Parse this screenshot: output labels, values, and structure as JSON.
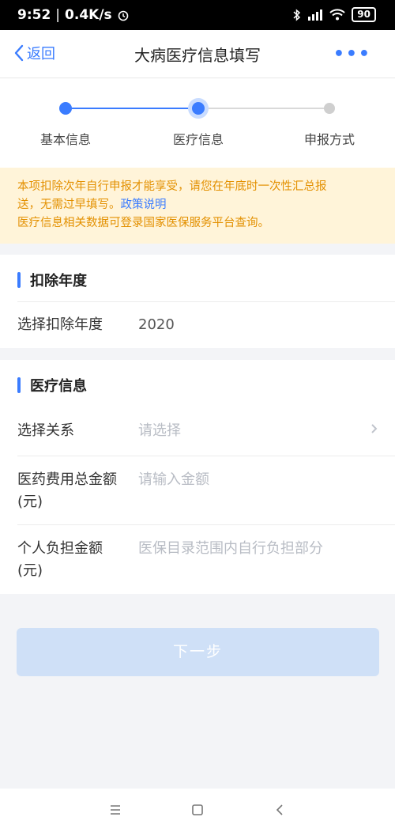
{
  "status": {
    "time": "9:52",
    "net": "0.4K/s",
    "battery": "90"
  },
  "nav": {
    "back_label": "返回",
    "title": "大病医疗信息填写",
    "more": "•••"
  },
  "steps": [
    {
      "label": "基本信息",
      "state": "done"
    },
    {
      "label": "医疗信息",
      "state": "current"
    },
    {
      "label": "申报方式",
      "state": "pending"
    }
  ],
  "notice": {
    "line1": "本项扣除次年自行申报才能享受，请您在年底时一次性汇总报",
    "line2_text": "送，无需过早填写。",
    "line2_link": "政策说明",
    "line3": "医疗信息相关数据可登录国家医保服务平台查询。"
  },
  "year_section": {
    "title": "扣除年度",
    "row_label": "选择扣除年度",
    "row_value": "2020"
  },
  "medical_section": {
    "title": "医疗信息",
    "relation_label": "选择关系",
    "relation_placeholder": "请选择",
    "total_label": "医药费用总金额(元)",
    "total_placeholder": "请输入金额",
    "personal_label": "个人负担金额(元)",
    "personal_placeholder": "医保目录范围内自行负担部分"
  },
  "next_button": "下一步",
  "colors": {
    "accent": "#3a7cff",
    "notice_bg": "#fff4d9",
    "notice_text": "#e39000",
    "button_disabled": "#cfe0f7"
  }
}
